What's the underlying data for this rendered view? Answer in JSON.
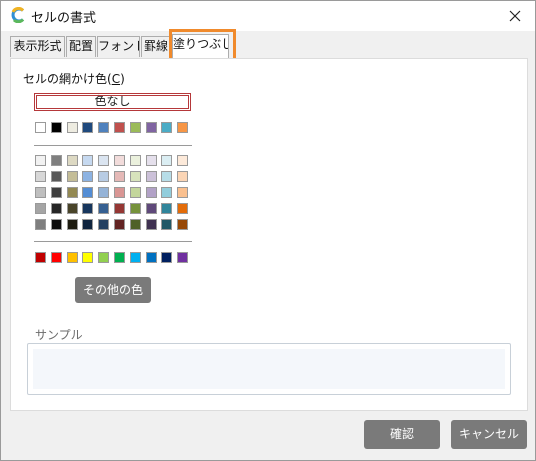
{
  "window": {
    "title": "セルの書式",
    "app_icon": "app-logo-icon",
    "close_icon": "close-icon"
  },
  "tabs": [
    {
      "label": "表示形式",
      "active": false
    },
    {
      "label": "配置",
      "active": false
    },
    {
      "label": "フォント",
      "active": false
    },
    {
      "label": "罫線",
      "active": false
    },
    {
      "label": "塗りつぶし",
      "active": true
    }
  ],
  "fill": {
    "shading_label_prefix": "セルの網かけ色(",
    "shading_label_key": "C",
    "shading_label_suffix": ")",
    "no_color_label": "色なし",
    "theme_base": [
      "#ffffff",
      "#000000",
      "#eeece1",
      "#1f497d",
      "#4f81bd",
      "#c0504d",
      "#9bbb59",
      "#8064a2",
      "#4bacc6",
      "#f79646"
    ],
    "theme_tints": [
      [
        "#f2f2f2",
        "#7f7f7f",
        "#ddd9c3",
        "#c6d9f0",
        "#dbe5f1",
        "#f2dcdb",
        "#ebf1dd",
        "#e5e0ec",
        "#dbeef3",
        "#fdeada"
      ],
      [
        "#d8d8d8",
        "#595959",
        "#c4bd97",
        "#8db3e2",
        "#b8cce4",
        "#e5b9b7",
        "#d7e3bc",
        "#ccc1d9",
        "#b7dde8",
        "#fbd5b5"
      ],
      [
        "#bfbfbf",
        "#3f3f3f",
        "#938953",
        "#548dd4",
        "#95b3d7",
        "#d99694",
        "#c3d69b",
        "#b2a2c7",
        "#92cddc",
        "#fac08f"
      ],
      [
        "#a5a5a5",
        "#262626",
        "#494429",
        "#17365d",
        "#366092",
        "#953734",
        "#76923c",
        "#5f497a",
        "#31859b",
        "#e36c09"
      ],
      [
        "#7f7f7f",
        "#0c0c0c",
        "#1d1b10",
        "#0f243e",
        "#244061",
        "#632423",
        "#4f6128",
        "#3f3151",
        "#205867",
        "#974806"
      ]
    ],
    "standard": [
      "#c00000",
      "#ff0000",
      "#ffc000",
      "#ffff00",
      "#92d050",
      "#00b050",
      "#00b0f0",
      "#0070c0",
      "#002060",
      "#7030a0"
    ],
    "more_colors_label": "その他の色",
    "sample_label": "サンプル"
  },
  "buttons": {
    "ok": "確認",
    "cancel": "キャンセル"
  }
}
